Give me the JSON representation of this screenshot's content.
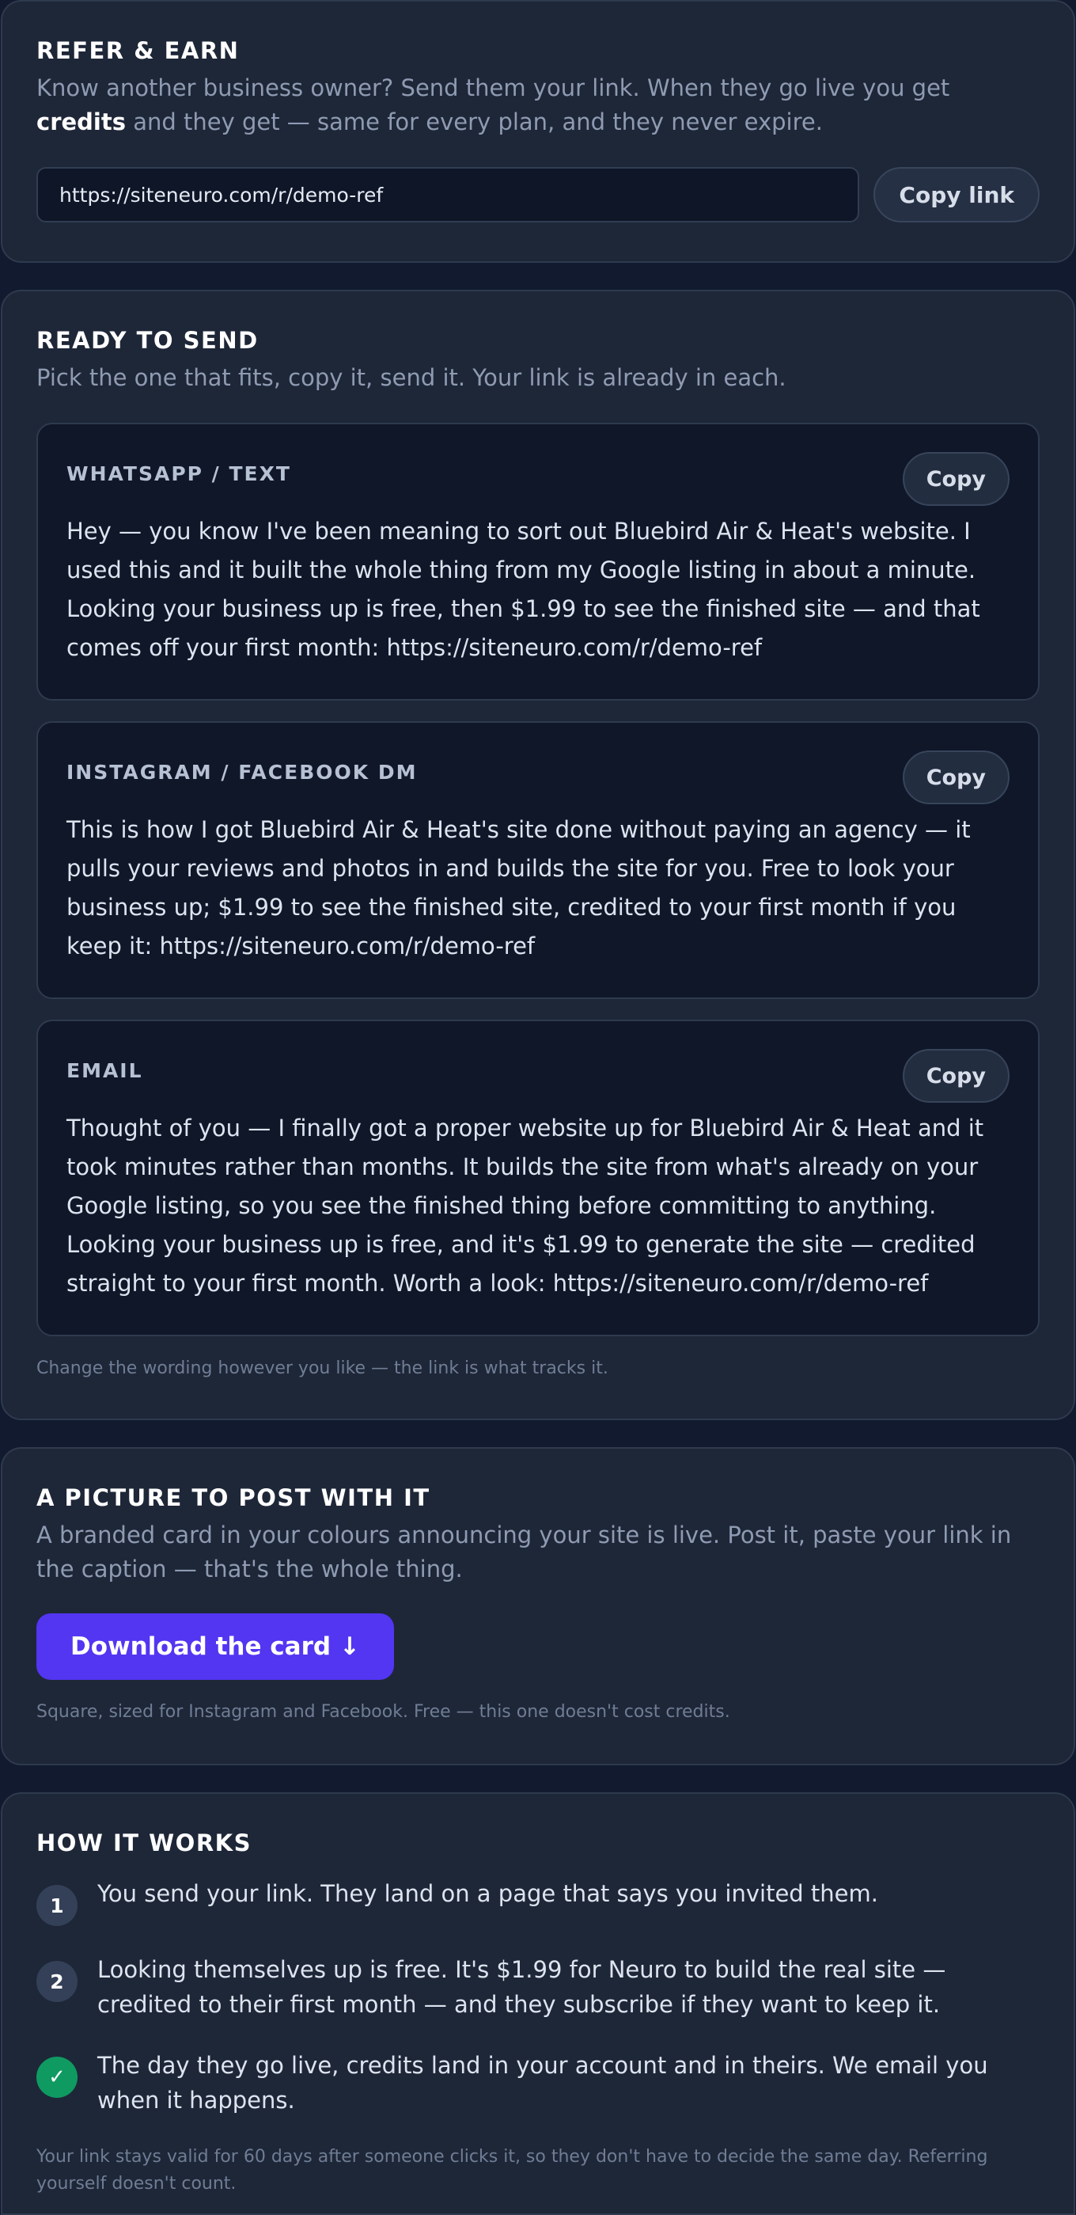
{
  "refer": {
    "title": "REFER & EARN",
    "desc_before": "Know another business owner? Send them your link. When they go live you get ",
    "desc_bold": "credits",
    "desc_after": " and they get — same for every plan, and they never expire.",
    "link_value": "https://siteneuro.com/r/demo-ref",
    "copy_link_label": "Copy link"
  },
  "ready": {
    "title": "READY TO SEND",
    "subtitle": "Pick the one that fits, copy it, send it. Your link is already in each.",
    "messages": [
      {
        "label": "WHATSAPP / TEXT",
        "copy_label": "Copy",
        "text": "Hey — you know I've been meaning to sort out Bluebird Air & Heat's website. I used this and it built the whole thing from my Google listing in about a minute. Looking your business up is free, then $1.99 to see the finished site — and that comes off your first month: https://siteneuro.com/r/demo-ref"
      },
      {
        "label": "INSTAGRAM / FACEBOOK DM",
        "copy_label": "Copy",
        "text": "This is how I got Bluebird Air & Heat's site done without paying an agency — it pulls your reviews and photos in and builds the site for you. Free to look your business up; $1.99 to see the finished site, credited to your first month if you keep it: https://siteneuro.com/r/demo-ref"
      },
      {
        "label": "EMAIL",
        "copy_label": "Copy",
        "text": "Thought of you — I finally got a proper website up for Bluebird Air & Heat and it took minutes rather than months. It builds the site from what's already on your Google listing, so you see the finished thing before committing to anything. Looking your business up is free, and it's $1.99 to generate the site — credited straight to your first month. Worth a look: https://siteneuro.com/r/demo-ref"
      }
    ],
    "note": "Change the wording however you like — the link is what tracks it."
  },
  "picture": {
    "title": "A PICTURE TO POST WITH IT",
    "subtitle": "A branded card in your colours announcing your site is live. Post it, paste your link in the caption — that's the whole thing.",
    "download_label": "Download the card ↓",
    "note": "Square, sized for Instagram and Facebook. Free — this one doesn't cost credits."
  },
  "how": {
    "title": "HOW IT WORKS",
    "steps": [
      {
        "marker": "1",
        "text": "You send your link. They land on a page that says you invited them."
      },
      {
        "marker": "2",
        "text": "Looking themselves up is free. It's $1.99 for Neuro to build the real site — credited to their first month — and they subscribe if they want to keep it."
      },
      {
        "marker": "✓",
        "text": "The day they go live, credits land in your account and in theirs. We email you when it happens."
      }
    ],
    "note": "Your link stays valid for 60 days after someone clicks it, so they don't have to decide the same day. Referring yourself doesn't count."
  },
  "colors": {
    "background": "#111a2e",
    "card": "#1e2738",
    "accent": "#5236f2",
    "success": "#0f9a61"
  }
}
